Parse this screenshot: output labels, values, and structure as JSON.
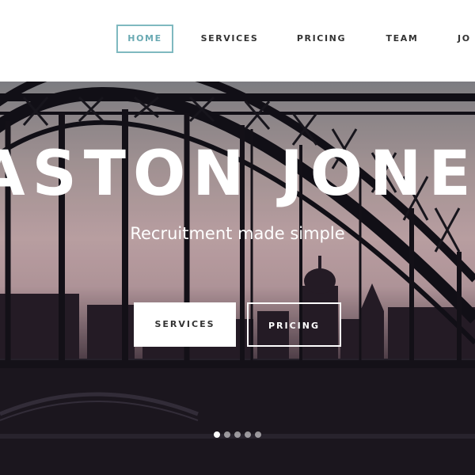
{
  "nav": {
    "items": [
      {
        "label": "HOME",
        "active": true
      },
      {
        "label": "SERVICES",
        "active": false
      },
      {
        "label": "PRICING",
        "active": false
      },
      {
        "label": "TEAM",
        "active": false
      },
      {
        "label": "JO",
        "active": false
      }
    ],
    "accent_color": "#7fb9c0"
  },
  "hero": {
    "title": "ASTON JONES",
    "subtitle": "Recruitment made simple",
    "buttons": {
      "services_label": "SERVICES",
      "pricing_label": "PRICING"
    },
    "slider": {
      "slide_count": 5,
      "active_index": 0
    }
  }
}
